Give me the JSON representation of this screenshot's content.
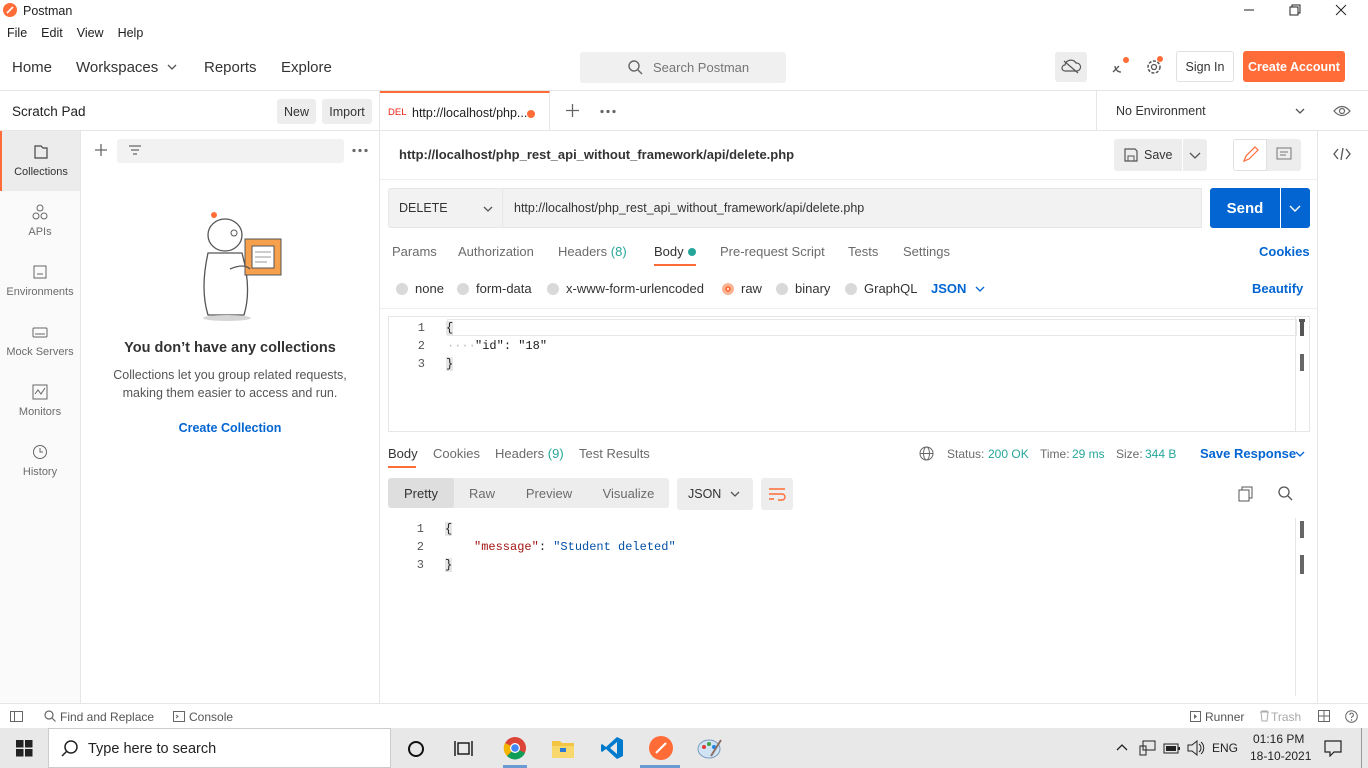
{
  "window": {
    "title": "Postman"
  },
  "menu": [
    "File",
    "Edit",
    "View",
    "Help"
  ],
  "header": {
    "home": "Home",
    "workspaces": "Workspaces",
    "reports": "Reports",
    "explore": "Explore",
    "search_placeholder": "Search Postman",
    "sign_in": "Sign In",
    "create_account": "Create Account"
  },
  "scratch": {
    "title": "Scratch Pad",
    "new": "New",
    "import": "Import"
  },
  "sidebar": [
    {
      "label": "Collections",
      "icon": "collections-icon"
    },
    {
      "label": "APIs",
      "icon": "apis-icon"
    },
    {
      "label": "Environments",
      "icon": "environments-icon"
    },
    {
      "label": "Mock Servers",
      "icon": "mock-servers-icon"
    },
    {
      "label": "Monitors",
      "icon": "monitors-icon"
    },
    {
      "label": "History",
      "icon": "history-icon"
    }
  ],
  "empty": {
    "title": "You don’t have any collections",
    "line1": "Collections let you group related requests,",
    "line2": "making them easier to access and run.",
    "cta": "Create Collection"
  },
  "tab": {
    "method": "DEL",
    "title": "http://localhost/php..."
  },
  "environment": "No Environment",
  "request": {
    "name": "http://localhost/php_rest_api_without_framework/api/delete.php",
    "save": "Save",
    "method": "DELETE",
    "url": "http://localhost/php_rest_api_without_framework/api/delete.php",
    "send": "Send"
  },
  "req_tabs": {
    "params": "Params",
    "auth": "Authorization",
    "headers": "Headers",
    "headers_count": "(8)",
    "body": "Body",
    "prereq": "Pre-request Script",
    "tests": "Tests",
    "settings": "Settings",
    "cookies": "Cookies"
  },
  "body_types": {
    "none": "none",
    "form": "form-data",
    "urlenc": "x-www-form-urlencoded",
    "raw": "raw",
    "binary": "binary",
    "graphql": "GraphQL",
    "format": "JSON",
    "beautify": "Beautify"
  },
  "req_body": {
    "l1": "{",
    "l2_key": "\"id\"",
    "l2_colon": ": ",
    "l2_val": "\"18\"",
    "l3": "}",
    "n1": "1",
    "n2": "2",
    "n3": "3"
  },
  "resp_tabs": {
    "body": "Body",
    "cookies": "Cookies",
    "headers": "Headers",
    "headers_count": "(9)",
    "tests": "Test Results"
  },
  "resp_meta": {
    "status_label": "Status:",
    "status": "200 OK",
    "time_label": "Time:",
    "time": "29 ms",
    "size_label": "Size:",
    "size": "344 B",
    "save": "Save Response"
  },
  "resp_view": {
    "pretty": "Pretty",
    "raw": "Raw",
    "preview": "Preview",
    "visualize": "Visualize",
    "format": "JSON"
  },
  "resp_body": {
    "l1": "{",
    "l2_key": "\"message\"",
    "l2_colon": ": ",
    "l2_val": "\"Student deleted\"",
    "l3": "}",
    "n1": "1",
    "n2": "2",
    "n3": "3"
  },
  "statusbar": {
    "find": "Find and Replace",
    "console": "Console",
    "runner": "Runner",
    "trash": "Trash"
  },
  "taskbar": {
    "search": "Type here to search",
    "lang": "ENG",
    "time": "01:16 PM",
    "date": "18-10-2021"
  },
  "colors": {
    "accent": "#ff6c37",
    "blue": "#0265d2",
    "green": "#26a69a"
  }
}
